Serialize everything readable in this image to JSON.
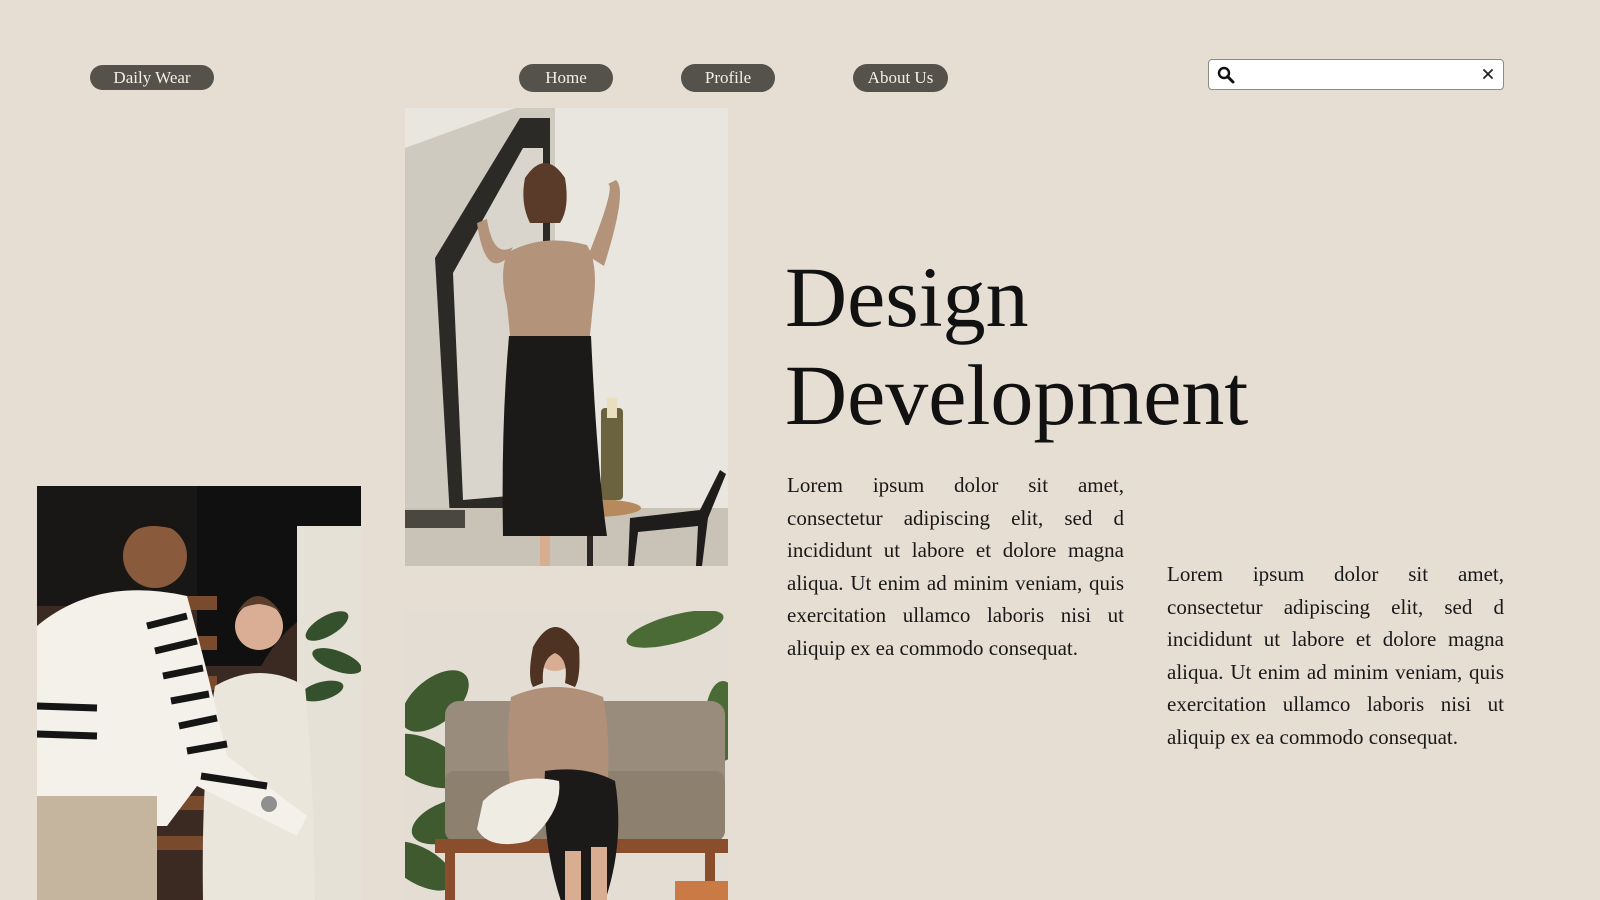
{
  "header": {
    "brand_label": "Daily Wear",
    "nav": {
      "home": "Home",
      "profile": "Profile",
      "about": "About Us"
    },
    "search": {
      "value": "",
      "placeholder": "",
      "icon": "search-icon",
      "clear_icon": "close-icon"
    }
  },
  "hero": {
    "title_line1": "Design",
    "title_line2": "Development"
  },
  "paragraphs": {
    "left": "Lorem ipsum dolor sit amet, consectetur adipiscing elit, sed d incididunt ut labore et dolore magna aliqua. Ut enim ad minim veniam, quis exercitation ullamco laboris nisi ut aliquip ex ea commodo consequat.",
    "right": "Lorem ipsum dolor sit amet, consectetur adipiscing elit, sed d incididunt ut labore et dolore magna aliqua. Ut enim ad minim veniam, quis exercitation ullamco laboris nisi ut aliquip ex ea commodo consequat."
  },
  "colors": {
    "background": "#e6ded3",
    "pill": "#54524a",
    "pill_text": "#f4efe6",
    "text": "#111111"
  }
}
